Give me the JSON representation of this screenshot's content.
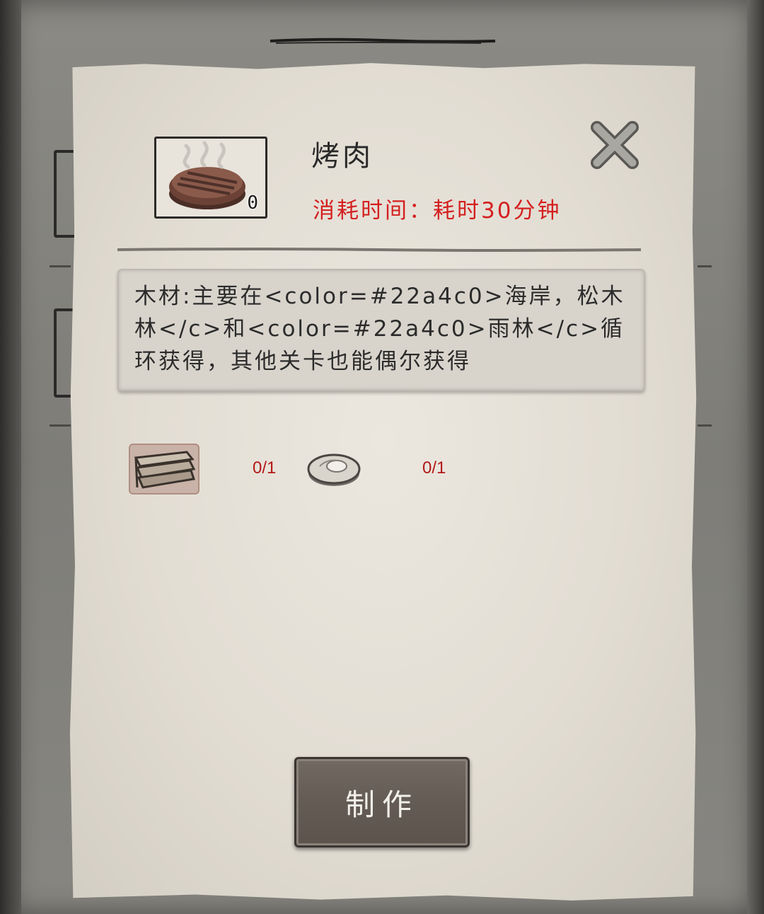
{
  "item": {
    "name": "烤肉",
    "owned_count": "0",
    "icon": "roasted-meat-icon"
  },
  "time_cost": "消耗时间：耗时30分钟",
  "description": "木材:主要在<color=#22a4c0>海岸，松木林</c>和<color=#22a4c0>雨林</c>循环获得，其他关卡也能偶尔获得",
  "materials": [
    {
      "icon": "wood-planks-icon",
      "count": "0/1"
    },
    {
      "icon": "raw-meat-icon",
      "count": "0/1"
    }
  ],
  "craft_button": "制作",
  "colors": {
    "time_text": "#d42020",
    "material_count": "#b21818",
    "button": "#655c56"
  }
}
